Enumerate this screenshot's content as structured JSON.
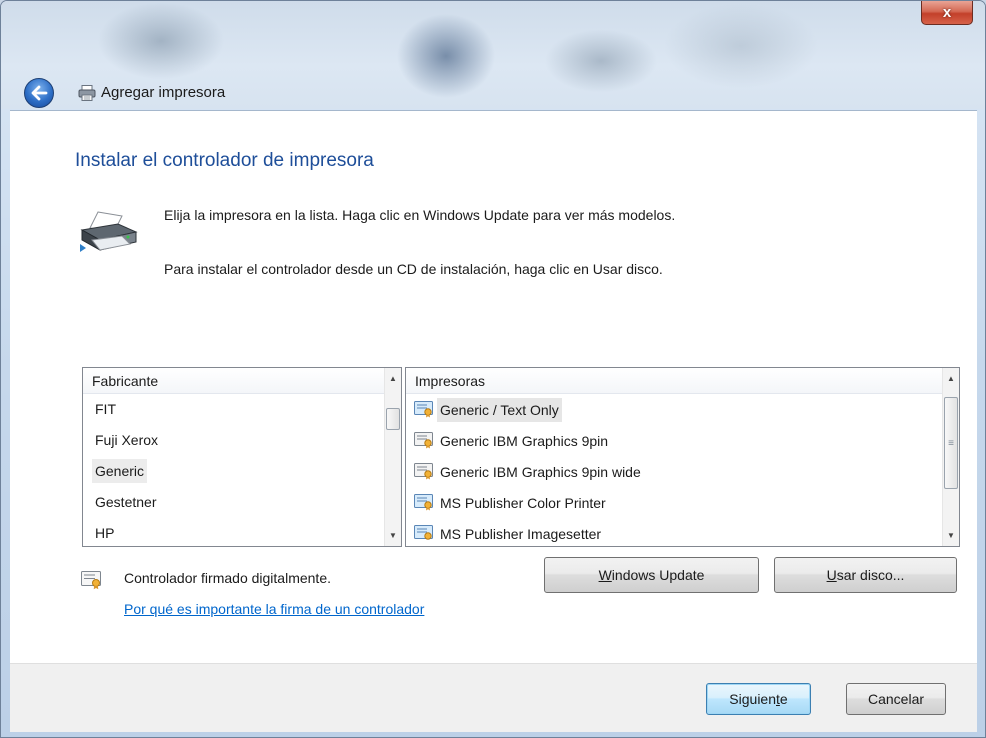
{
  "window": {
    "title": "Agregar impresora",
    "close_label": "x"
  },
  "page": {
    "heading": "Instalar el controlador de impresora",
    "instruction_1": "Elija la impresora en la lista. Haga clic en Windows Update para ver más modelos.",
    "instruction_2": "Para instalar el controlador desde un CD de instalación, haga clic en Usar disco."
  },
  "manufacturers": {
    "header": "Fabricante",
    "items": [
      "FIT",
      "Fuji Xerox",
      "Generic",
      "Gestetner",
      "HP"
    ],
    "selected": "Generic"
  },
  "printers": {
    "header": "Impresoras",
    "items": [
      "Generic / Text Only",
      "Generic IBM Graphics 9pin",
      "Generic IBM Graphics 9pin wide",
      "MS Publisher Color Printer",
      "MS Publisher Imagesetter"
    ],
    "selected": "Generic / Text Only"
  },
  "signature": {
    "status": "Controlador firmado digitalmente.",
    "link": "Por qué es importante la firma de un controlador"
  },
  "buttons": {
    "windows_update_access": "W",
    "windows_update_rest": "indows Update",
    "usar_disco_access": "U",
    "usar_disco_rest": "sar disco...",
    "siguiente_pre": "Siguien",
    "siguiente_access": "t",
    "siguiente_post": "e",
    "cancelar": "Cancelar"
  },
  "colors": {
    "heading": "#1e4e99",
    "link": "#0066cc",
    "default_button_border": "#3c7fb1"
  }
}
